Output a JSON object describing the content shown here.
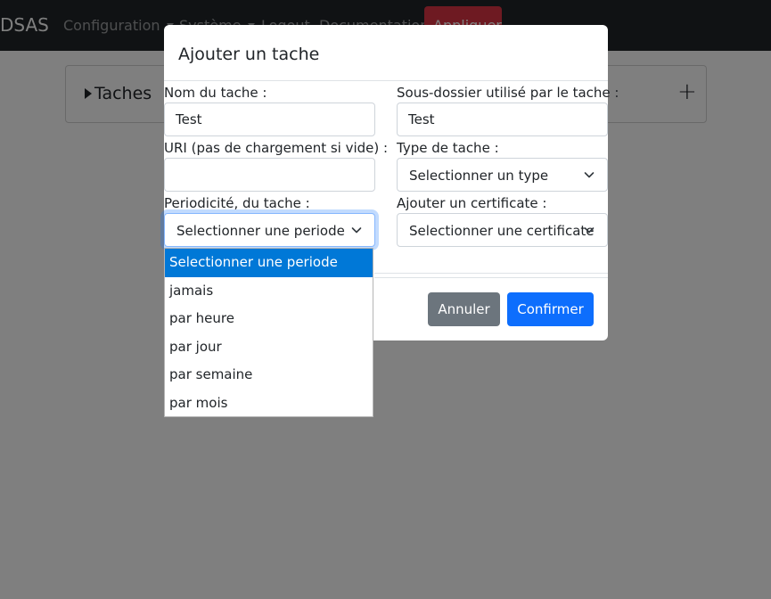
{
  "navbar": {
    "brand": "DSAS",
    "links": [
      "Configuration",
      "Système",
      "Logout",
      "Documentation"
    ],
    "apply_label": "Appliquer"
  },
  "card": {
    "title": "Taches",
    "add_symbol": "+"
  },
  "modal": {
    "title": "Ajouter un tache",
    "fields": {
      "name_label": "Nom du tache :",
      "name_value": "Test",
      "subfolder_label": "Sous-dossier utilisé par le tache :",
      "subfolder_value": "Test",
      "uri_label": "URI (pas de chargement si vide) :",
      "uri_value": "",
      "type_label": "Type de tache :",
      "type_selected": "Selectionner un type",
      "period_label": "Periodicité, du tache :",
      "period_selected": "Selectionner une periode",
      "certificate_label": "Ajouter un certificate :",
      "certificate_selected": "Selectionner une certificate"
    },
    "cancel_label": "Annuler",
    "confirm_label": "Confirmer"
  },
  "period_options": [
    "Selectionner une periode",
    "jamais",
    "par heure",
    "par jour",
    "par semaine",
    "par mois"
  ],
  "selected_option_index": 0,
  "colors": {
    "navbar_bg": "#212529",
    "apply_btn": "#dc3545",
    "cancel_btn": "#6c757d",
    "confirm_btn": "#0d6efd",
    "selected_option": "#0078d7"
  }
}
